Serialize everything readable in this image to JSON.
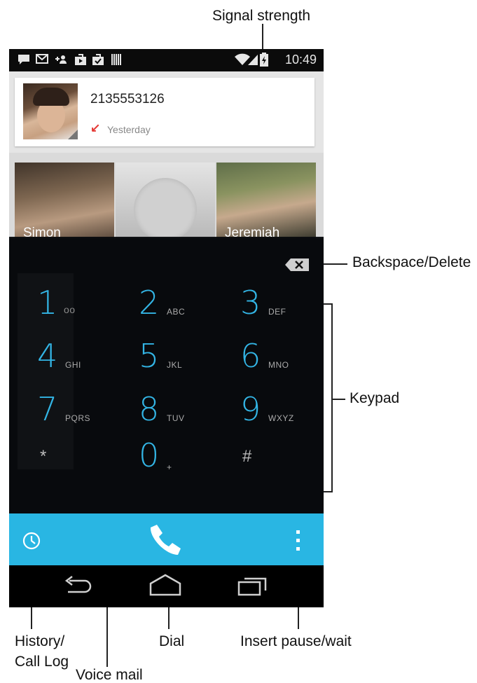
{
  "callouts": {
    "signal": "Signal strength",
    "backspace": "Backspace/Delete",
    "keypad": "Keypad",
    "history_1": "History/",
    "history_2": "Call Log",
    "dial": "Dial",
    "pause": "Insert pause/wait",
    "voicemail": "Voice mail"
  },
  "status_bar": {
    "time": "10:49",
    "icons": [
      "message-icon",
      "gmail-icon",
      "add-contact-icon",
      "play-store-icon",
      "shopping-bag-icon",
      "barcode-icon",
      "wifi-icon",
      "signal-icon",
      "battery-charging-icon"
    ]
  },
  "recent": {
    "number": "2135553126",
    "call_type_icon": "missed-call-icon",
    "time": "Yesterday"
  },
  "favorites": [
    {
      "name": "Simon"
    },
    {
      "name": ""
    },
    {
      "name": "Jeremiah"
    }
  ],
  "keypad": {
    "keys": [
      {
        "digit": "1",
        "letters": "oo"
      },
      {
        "digit": "2",
        "letters": "ABC"
      },
      {
        "digit": "3",
        "letters": "DEF"
      },
      {
        "digit": "4",
        "letters": "GHI"
      },
      {
        "digit": "5",
        "letters": "JKL"
      },
      {
        "digit": "6",
        "letters": "MNO"
      },
      {
        "digit": "7",
        "letters": "PQRS"
      },
      {
        "digit": "8",
        "letters": "TUV"
      },
      {
        "digit": "9",
        "letters": "WXYZ"
      },
      {
        "digit": "*",
        "letters": ""
      },
      {
        "digit": "0",
        "letters": "+"
      },
      {
        "digit": "#",
        "letters": ""
      }
    ]
  },
  "colors": {
    "accent": "#33b5e5",
    "action_bar": "#29b6e3",
    "missed_call": "#e53935"
  },
  "action_bar_icons": [
    "history-icon",
    "phone-icon",
    "overflow-menu-icon"
  ],
  "nav_icons": [
    "back-icon",
    "home-icon",
    "recents-icon"
  ]
}
